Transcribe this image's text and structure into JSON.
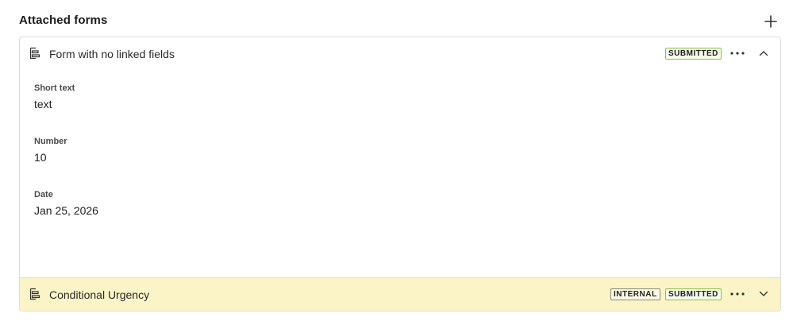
{
  "header": {
    "title": "Attached forms",
    "add_icon": "plus-icon"
  },
  "forms": [
    {
      "name": "Form with no linked fields",
      "icon": "form-icon",
      "expanded": true,
      "badges": [
        "SUBMITTED"
      ],
      "fields": [
        {
          "label": "Short text",
          "value": "text"
        },
        {
          "label": "Number",
          "value": "10"
        },
        {
          "label": "Date",
          "value": "Jan 25, 2026"
        }
      ]
    },
    {
      "name": "Conditional Urgency",
      "icon": "form-icon",
      "expanded": false,
      "badges": [
        "INTERNAL",
        "SUBMITTED"
      ],
      "highlight_color": "#faf4c6"
    }
  ],
  "colors": {
    "submitted_border": "#8ec24a",
    "highlight": "#faf4c6"
  }
}
